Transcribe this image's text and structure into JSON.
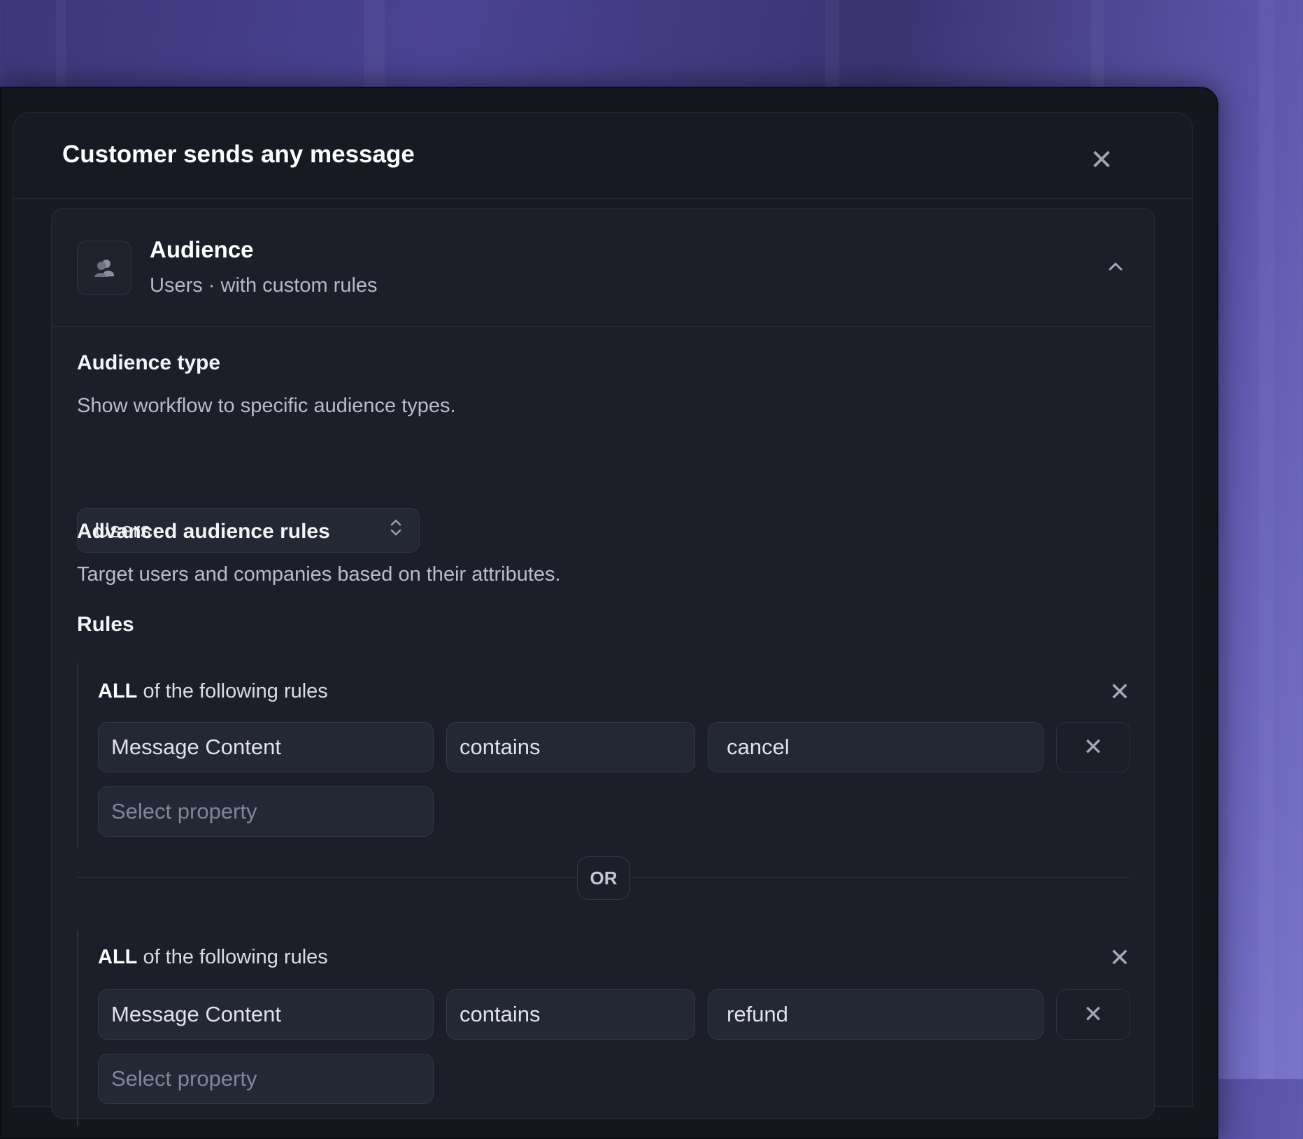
{
  "modal": {
    "title": "Customer sends any message",
    "close_icon": "✕"
  },
  "audience": {
    "title": "Audience",
    "subtitle": "Users · with custom rules",
    "type_label": "Audience type",
    "type_desc": "Show workflow to specific audience types.",
    "type_value": "Users",
    "advanced_label": "Advanced audience rules",
    "advanced_desc": "Target users and companies based on their attributes.",
    "rules_label": "Rules"
  },
  "rule_groups": [
    {
      "quantifier": "ALL",
      "label_rest": "of the following rules",
      "property": "Message Content",
      "operator": "contains",
      "value": "cancel",
      "placeholder": "Select property"
    },
    {
      "quantifier": "ALL",
      "label_rest": "of the following rules",
      "property": "Message Content",
      "operator": "contains",
      "value": "refund",
      "placeholder": "Select property"
    }
  ],
  "or_label": "OR",
  "x_glyph": "✕",
  "colors": {
    "background_accent": "#4a4392",
    "panel": "#1c1e29",
    "field": "#242734"
  },
  "icons": [
    "close-icon",
    "users-icon",
    "chevron-up-icon",
    "up-down-icon",
    "remove-icon"
  ]
}
